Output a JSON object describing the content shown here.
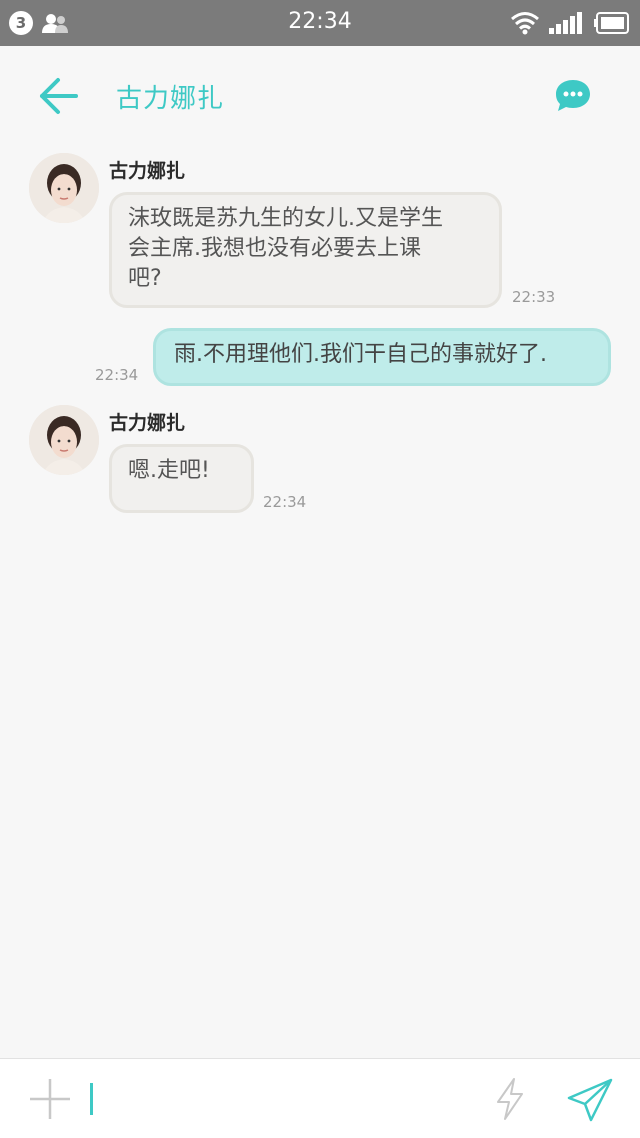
{
  "status_bar": {
    "notification_count": "3",
    "time": "22:34",
    "icons": [
      "contacts-icon",
      "wifi-icon",
      "signal-icon",
      "battery-icon"
    ]
  },
  "header": {
    "title": "古力娜扎",
    "back_icon": "arrow-left-icon",
    "menu_icon": "chat-bubble-dots-icon"
  },
  "messages": [
    {
      "direction": "in",
      "sender": "古力娜扎",
      "lines": [
        "沫玫既是苏九生的女儿.又是学生",
        "会主席.我想也没有必要去上课",
        "吧?"
      ],
      "time": "22:33"
    },
    {
      "direction": "out",
      "text": "雨.不用理他们.我们干自己的事就好了.",
      "time": "22:34"
    },
    {
      "direction": "in",
      "sender": "古力娜扎",
      "text": "嗯.走吧!",
      "time": "22:34"
    }
  ],
  "input_bar": {
    "value": "",
    "icons": [
      "plus-icon",
      "lightning-icon",
      "send-icon"
    ]
  },
  "colors": {
    "accent": "#3ec9c5",
    "status_bar": "#7b7b7b",
    "incoming_bubble": "#f1f0ee",
    "outgoing_bubble": "#bfecea",
    "background": "#f7f7f7"
  }
}
